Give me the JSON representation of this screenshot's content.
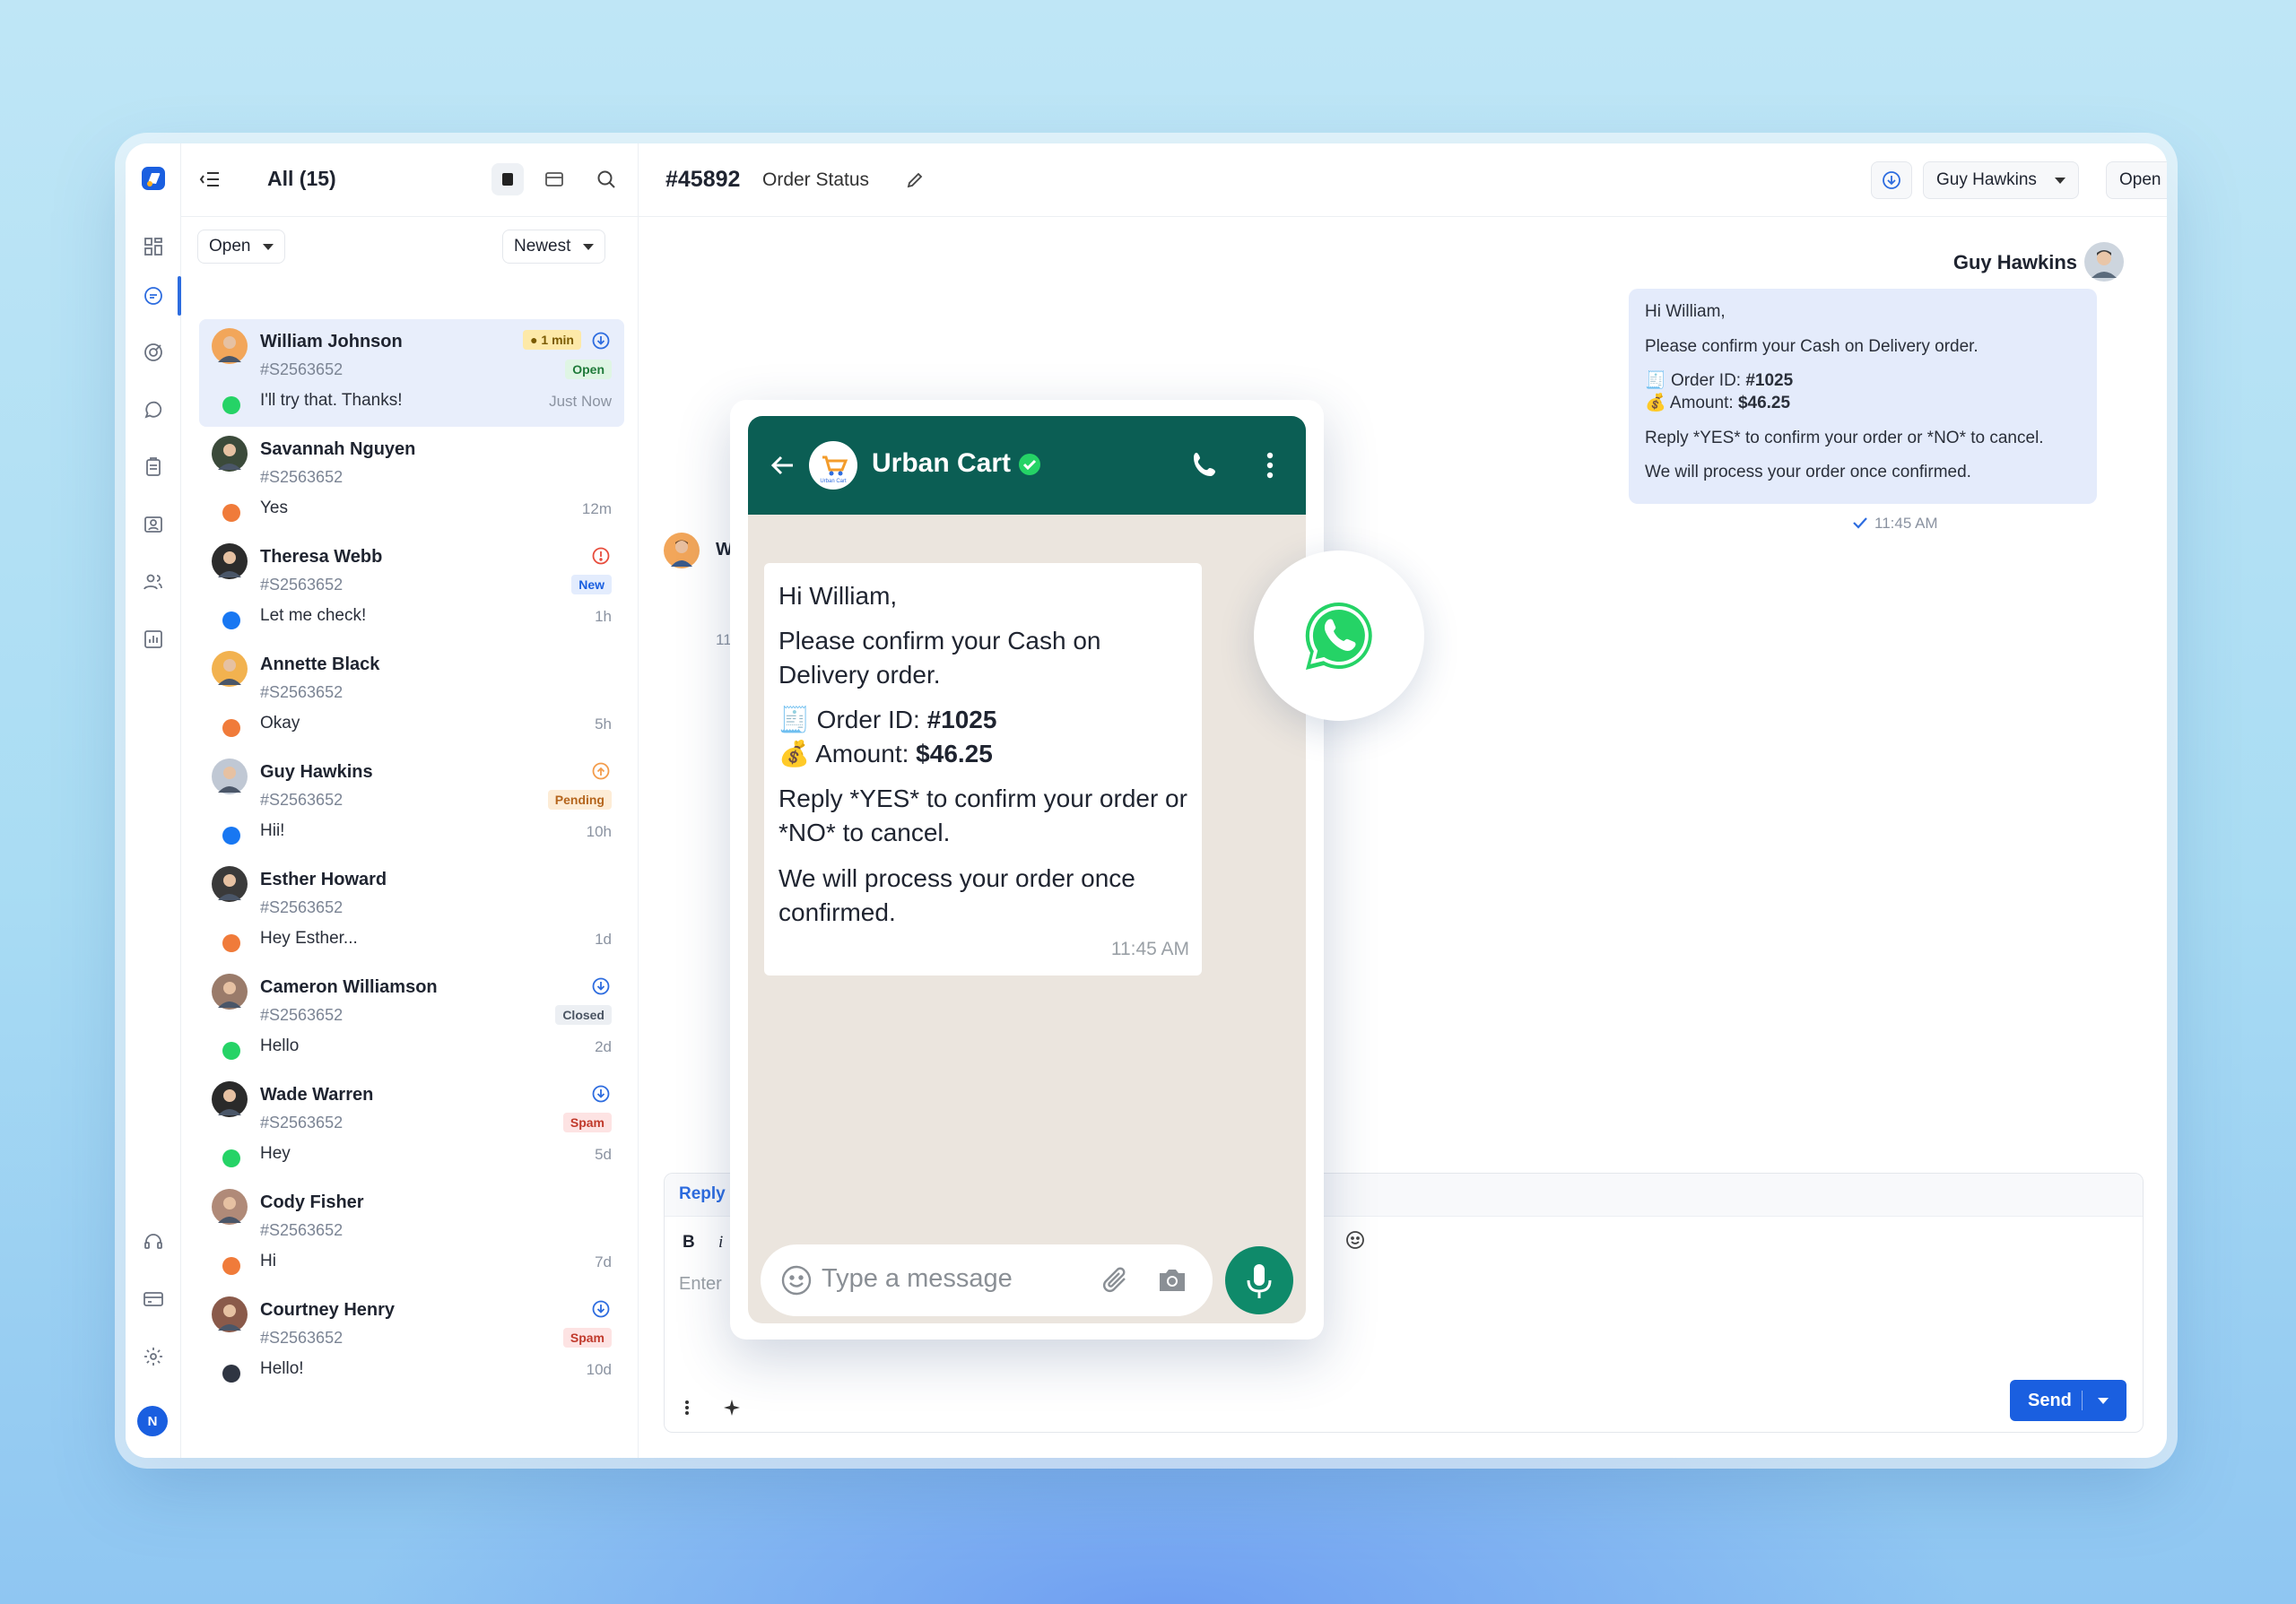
{
  "list": {
    "title": "All (15)",
    "filter": "Open",
    "sort": "Newest"
  },
  "conversations": [
    {
      "name": "William Johnson",
      "id": "#S2563652",
      "msg": "I'll try that. Thanks!",
      "time": "Just Now",
      "badge": "Open",
      "timer": "1 min",
      "channel": "whatsapp"
    },
    {
      "name": "Savannah Nguyen",
      "id": "#S2563652",
      "msg": "Yes",
      "time": "12m",
      "badge": "",
      "channel": "chat"
    },
    {
      "name": "Theresa Webb",
      "id": "#S2563652",
      "msg": "Let me check!",
      "time": "1h",
      "badge": "New",
      "channel": "facebook"
    },
    {
      "name": "Annette Black",
      "id": "#S2563652",
      "msg": "Okay",
      "time": "5h",
      "badge": "",
      "channel": "chat"
    },
    {
      "name": "Guy Hawkins",
      "id": "#S2563652",
      "msg": "Hii!",
      "time": "10h",
      "badge": "Pending",
      "channel": "facebook"
    },
    {
      "name": "Esther Howard",
      "id": "#S2563652",
      "msg": "Hey Esther...",
      "time": "1d",
      "badge": "",
      "channel": "chat"
    },
    {
      "name": "Cameron Williamson",
      "id": "#S2563652",
      "msg": "Hello",
      "time": "2d",
      "badge": "Closed",
      "channel": "whatsapp"
    },
    {
      "name": "Wade Warren",
      "id": "#S2563652",
      "msg": "Hey",
      "time": "5d",
      "badge": "Spam",
      "channel": "whatsapp"
    },
    {
      "name": "Cody Fisher",
      "id": "#S2563652",
      "msg": "Hi",
      "time": "7d",
      "badge": "",
      "channel": "chat"
    },
    {
      "name": "Courtney Henry",
      "id": "#S2563652",
      "msg": "Hello!",
      "time": "10d",
      "badge": "Spam",
      "channel": "email"
    }
  ],
  "ticket": {
    "id": "#45892",
    "subject": "Order Status",
    "assignee": "Guy Hawkins",
    "status": "Open"
  },
  "thread": {
    "agent": "Guy Hawkins",
    "greeting": "Hi William,",
    "line1": "Please confirm your Cash on Delivery order.",
    "order_label": "Order ID:",
    "order_id": "#1025",
    "amount_label": "Amount:",
    "amount": "$46.25",
    "reply_line": "Reply *YES* to confirm your order or *NO* to cancel.",
    "closing": "We will process your order once confirmed.",
    "time": "11:45 AM",
    "partial_initial": "W",
    "partial_time": "11:"
  },
  "composer": {
    "tab": "Reply",
    "placeholder": "Enter",
    "send": "Send",
    "bold": "B",
    "italic": "i"
  },
  "whatsapp": {
    "business": "Urban Cart",
    "logo_text": "Urban Cart",
    "greeting": "Hi William,",
    "line1": "Please confirm your Cash on Delivery order.",
    "order_label": "Order ID:",
    "order_id": "#1025",
    "amount_label": "Amount:",
    "amount": "$46.25",
    "reply_line": "Reply *YES* to confirm your order or *NO* to cancel.",
    "closing": "We will process your order once confirmed.",
    "time": "11:45 AM",
    "input_placeholder": "Type a message"
  },
  "user": {
    "initial": "N"
  },
  "colors": {
    "accent": "#1a5fe0",
    "whatsapp_header": "#0b5e54",
    "whatsapp_green": "#25d366",
    "selected_row": "#e8eefb",
    "agent_bubble": "#e4ebfb"
  }
}
